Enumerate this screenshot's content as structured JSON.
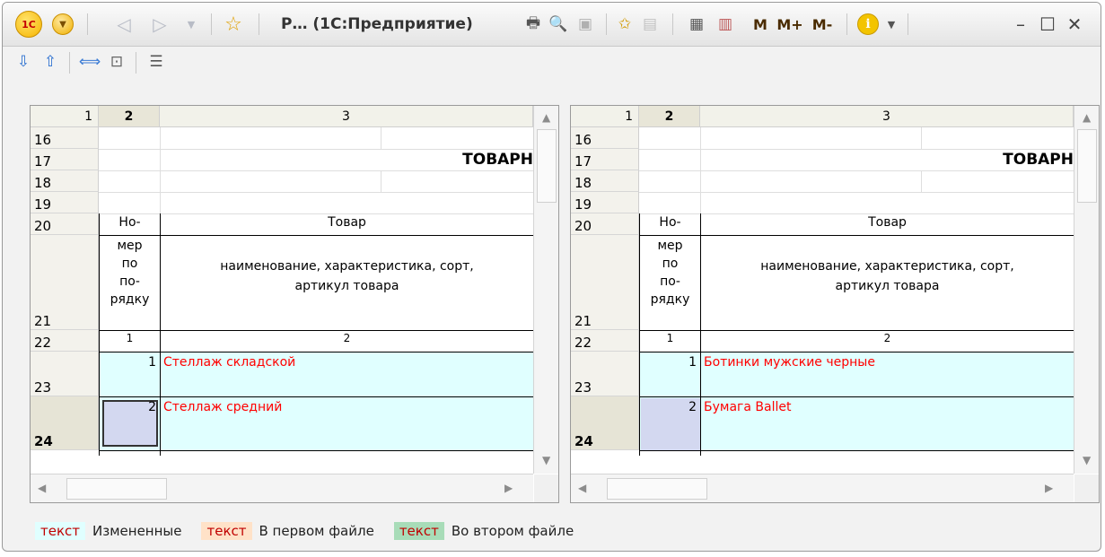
{
  "titlebar": {
    "logo_text": "1C",
    "title": "Р… (1С:Предприятие)",
    "m_buttons": [
      "M",
      "M+",
      "M-"
    ]
  },
  "table": {
    "col_headers": [
      "1",
      "2",
      "3"
    ],
    "rows": [
      "16",
      "17",
      "18",
      "19",
      "20",
      "21",
      "22",
      "23",
      "24"
    ],
    "heading": "ТОВАРН",
    "h20_col2": "Но-",
    "h20_col3": "Товар",
    "h21_col2_lines": [
      "мер",
      "по",
      "по-",
      "рядку"
    ],
    "h21_col3_lines": [
      "наименование, характеристика, сорт,",
      "артикул товара"
    ],
    "colnums": [
      "1",
      "2"
    ]
  },
  "left": {
    "items": [
      {
        "num": "1",
        "name": "Стеллаж складской"
      },
      {
        "num": "2",
        "name": "Стеллаж средний"
      }
    ]
  },
  "right": {
    "items": [
      {
        "num": "1",
        "name": "Ботинки мужские черные"
      },
      {
        "num": "2",
        "name": "Бумага Ballet"
      }
    ]
  },
  "legend": [
    {
      "swatch": "текст",
      "label": "Измененные",
      "color": "#e0ffff"
    },
    {
      "swatch": "текст",
      "label": "В первом файле",
      "color": "#ffe2c8"
    },
    {
      "swatch": "текст",
      "label": "Во втором файле",
      "color": "#a8dcb8"
    }
  ],
  "colors": {
    "changed_row": "#e0ffff",
    "selected_cell": "#d3d8f0",
    "diff_text": "#ff0000"
  }
}
